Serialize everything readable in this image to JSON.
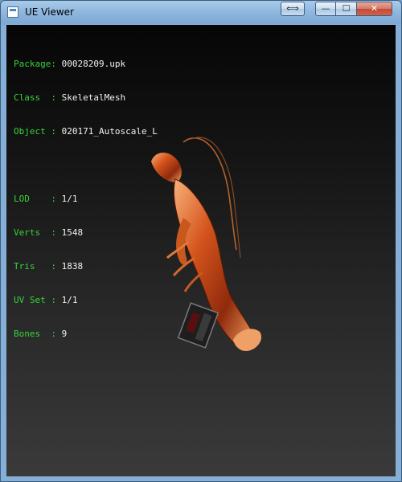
{
  "window": {
    "title": "UE Viewer",
    "icon": "app-icon",
    "buttons": {
      "resize": "⟺",
      "minimize": "—",
      "maximize": "☐",
      "close": "✕"
    }
  },
  "info": {
    "rows": [
      {
        "label": "Package: ",
        "value": "00028209.upk"
      },
      {
        "label": "Class  : ",
        "value": "SkeletalMesh"
      },
      {
        "label": "Object : ",
        "value": "020171_Autoscale_L"
      }
    ],
    "stats": [
      {
        "label": "LOD    : ",
        "value": "1/1"
      },
      {
        "label": "Verts  : ",
        "value": "1548"
      },
      {
        "label": "Tris   : ",
        "value": "1838"
      },
      {
        "label": "UV Set : ",
        "value": "1/1"
      },
      {
        "label": "Bones  : ",
        "value": "9"
      }
    ]
  },
  "colors": {
    "label": "#36d33a",
    "value": "#f2f2f2",
    "viewport_top": "#060606",
    "viewport_bottom": "#3a3a3a"
  }
}
